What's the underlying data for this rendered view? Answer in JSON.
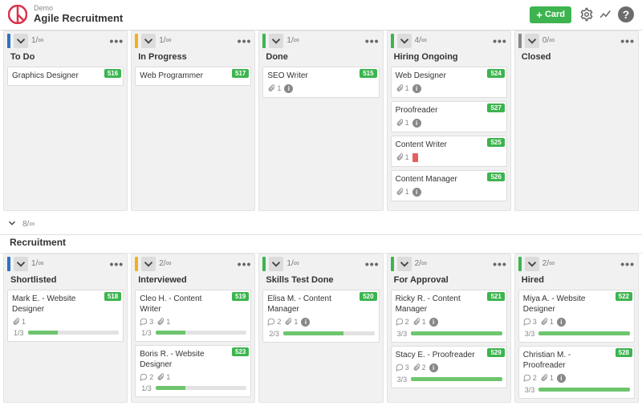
{
  "header": {
    "subtitle": "Demo",
    "title": "Agile Recruitment",
    "add_card_label": "Card"
  },
  "section1": {
    "swimlane_count": "",
    "columns": [
      {
        "color": "#2f71c5",
        "count": "1/∞",
        "title": "To Do",
        "cards": [
          {
            "id": "516",
            "title": "Graphics Designer"
          }
        ]
      },
      {
        "color": "#f2b01e",
        "count": "1/∞",
        "title": "In Progress",
        "cards": [
          {
            "id": "517",
            "title": "Web Programmer"
          }
        ]
      },
      {
        "color": "#3db44f",
        "count": "1/∞",
        "title": "Done",
        "cards": [
          {
            "id": "515",
            "title": "SEO Writer",
            "attach": "1",
            "info": true
          }
        ]
      },
      {
        "color": "#3db44f",
        "count": "4/∞",
        "title": "Hiring Ongoing",
        "cards": [
          {
            "id": "524",
            "title": "Web Designer",
            "attach": "1",
            "info": true
          },
          {
            "id": "527",
            "title": "Proofreader",
            "attach": "1",
            "info": true
          },
          {
            "id": "525",
            "title": "Content Writer",
            "attach": "1",
            "flag": true
          },
          {
            "id": "526",
            "title": "Content Manager",
            "attach": "1",
            "info": true
          }
        ]
      },
      {
        "color": "#888888",
        "count": "0/∞",
        "title": "Closed",
        "cards": []
      }
    ]
  },
  "section2": {
    "swimlane_count": "8/∞",
    "swimlane_name": "Recruitment",
    "columns": [
      {
        "color": "#2f71c5",
        "count": "1/∞",
        "title": "Shortlisted",
        "cards": [
          {
            "id": "518",
            "title": "Mark E. - Website Designer",
            "attach": "1",
            "sub_done": 1,
            "sub_total": 3,
            "progress": 33
          }
        ]
      },
      {
        "color": "#f2b01e",
        "count": "2/∞",
        "title": "Interviewed",
        "cards": [
          {
            "id": "519",
            "title": "Cleo H. - Content Writer",
            "comments": "3",
            "attach": "1",
            "sub_done": 1,
            "sub_total": 3,
            "progress": 33
          },
          {
            "id": "523",
            "title": "Boris R. - Website Designer",
            "comments": "2",
            "attach": "1",
            "sub_done": 1,
            "sub_total": 3,
            "progress": 33
          }
        ]
      },
      {
        "color": "#3db44f",
        "count": "1/∞",
        "title": "Skills Test Done",
        "cards": [
          {
            "id": "520",
            "title": "Elisa M. - Content Manager",
            "comments": "2",
            "attach": "1",
            "info": true,
            "sub_done": 2,
            "sub_total": 3,
            "progress": 66
          }
        ]
      },
      {
        "color": "#3db44f",
        "count": "2/∞",
        "title": "For Approval",
        "cards": [
          {
            "id": "521",
            "title": "Ricky R. - Content Manager",
            "comments": "2",
            "attach": "1",
            "info": true,
            "sub_done": 3,
            "sub_total": 3,
            "progress": 100
          },
          {
            "id": "529",
            "title": "Stacy E. - Proofreader",
            "comments": "3",
            "attach": "2",
            "info": true,
            "sub_done": 3,
            "sub_total": 3,
            "progress": 100
          }
        ]
      },
      {
        "color": "#3db44f",
        "count": "2/∞",
        "title": "Hired",
        "cards": [
          {
            "id": "522",
            "title": "Miya A. - Website Designer",
            "comments": "3",
            "attach": "1",
            "info": true,
            "sub_done": 3,
            "sub_total": 3,
            "progress": 100
          },
          {
            "id": "528",
            "title": "Christian M. - Proofreader",
            "comments": "2",
            "attach": "1",
            "info": true,
            "sub_done": 3,
            "sub_total": 3,
            "progress": 100
          }
        ]
      }
    ]
  }
}
